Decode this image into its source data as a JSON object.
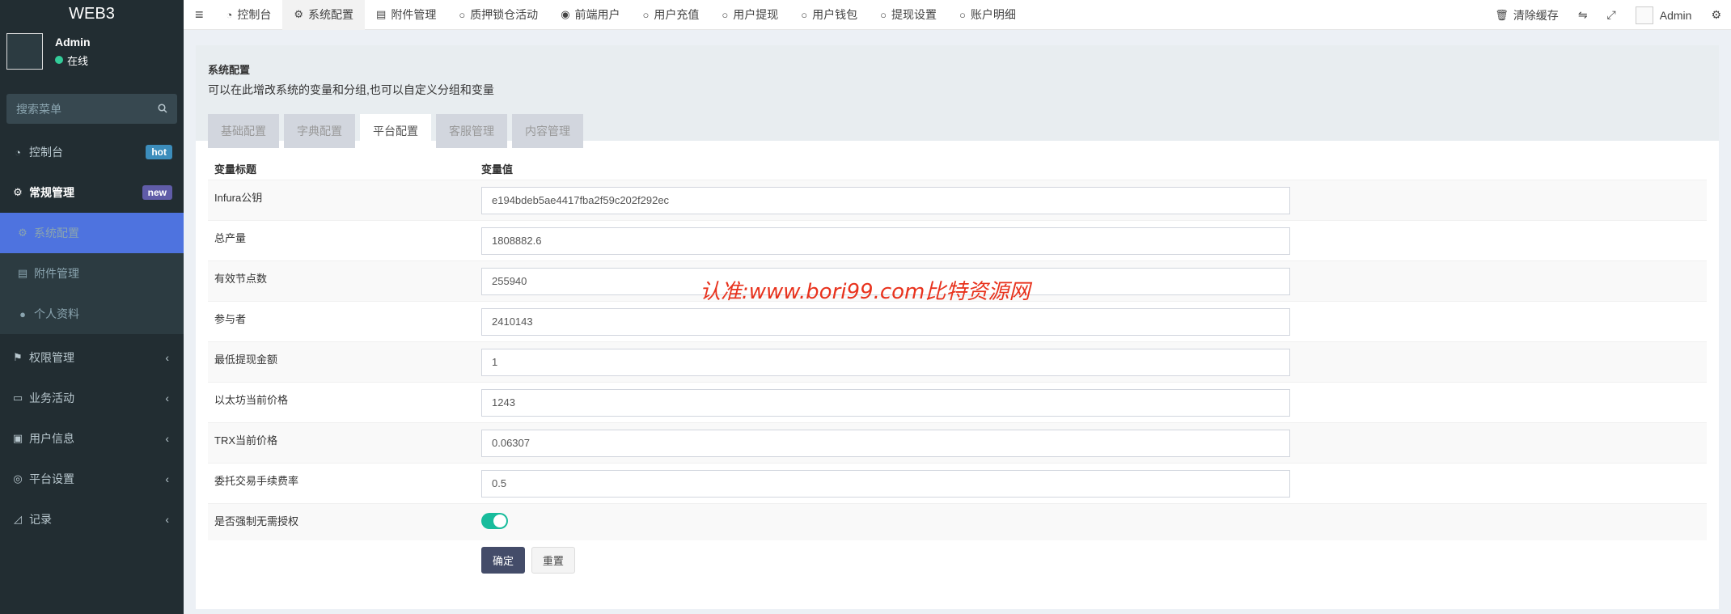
{
  "app": {
    "logo": "WEB3"
  },
  "user": {
    "name": "Admin",
    "status": "在线"
  },
  "search": {
    "placeholder": "搜索菜单"
  },
  "sidebar": {
    "items": [
      {
        "label": "控制台",
        "badge": "hot"
      },
      {
        "label": "常规管理",
        "badge": "new"
      },
      {
        "label": "系统配置"
      },
      {
        "label": "附件管理"
      },
      {
        "label": "个人资料"
      },
      {
        "label": "权限管理"
      },
      {
        "label": "业务活动"
      },
      {
        "label": "用户信息"
      },
      {
        "label": "平台设置"
      },
      {
        "label": "记录"
      }
    ]
  },
  "topnav": {
    "tabs": [
      {
        "label": "控制台"
      },
      {
        "label": "系统配置"
      },
      {
        "label": "附件管理"
      },
      {
        "label": "质押锁仓活动"
      },
      {
        "label": "前端用户"
      },
      {
        "label": "用户充值"
      },
      {
        "label": "用户提现"
      },
      {
        "label": "用户钱包"
      },
      {
        "label": "提现设置"
      },
      {
        "label": "账户明细"
      }
    ],
    "clear_cache": "清除缓存",
    "admin": "Admin"
  },
  "panel": {
    "title": "系统配置",
    "desc": "可以在此增改系统的变量和分组,也可以自定义分组和变量",
    "tabs": [
      "基础配置",
      "字典配置",
      "平台配置",
      "客服管理",
      "内容管理"
    ]
  },
  "table": {
    "headers": [
      "变量标题",
      "变量值"
    ],
    "rows": [
      {
        "label": "Infura公钥",
        "value": "e194bdeb5ae4417fba2f59c202f292ec"
      },
      {
        "label": "总产量",
        "value": "1808882.6"
      },
      {
        "label": "有效节点数",
        "value": "255940"
      },
      {
        "label": "参与者",
        "value": "2410143"
      },
      {
        "label": "最低提现金额",
        "value": "1"
      },
      {
        "label": "以太坊当前价格",
        "value": "1243"
      },
      {
        "label": "TRX当前价格",
        "value": "0.06307"
      },
      {
        "label": "委托交易手续费率",
        "value": "0.5"
      }
    ],
    "toggle_label": "是否强制无需授权"
  },
  "buttons": {
    "confirm": "确定",
    "reset": "重置"
  },
  "watermark": "认准:www.bori99.com比特资源网",
  "colors": {
    "sidebar_bg": "#222d32",
    "active_menu": "#4e73df",
    "toggle_on": "#18bc9c",
    "primary_btn": "#444c69",
    "watermark": "#e8321d"
  }
}
